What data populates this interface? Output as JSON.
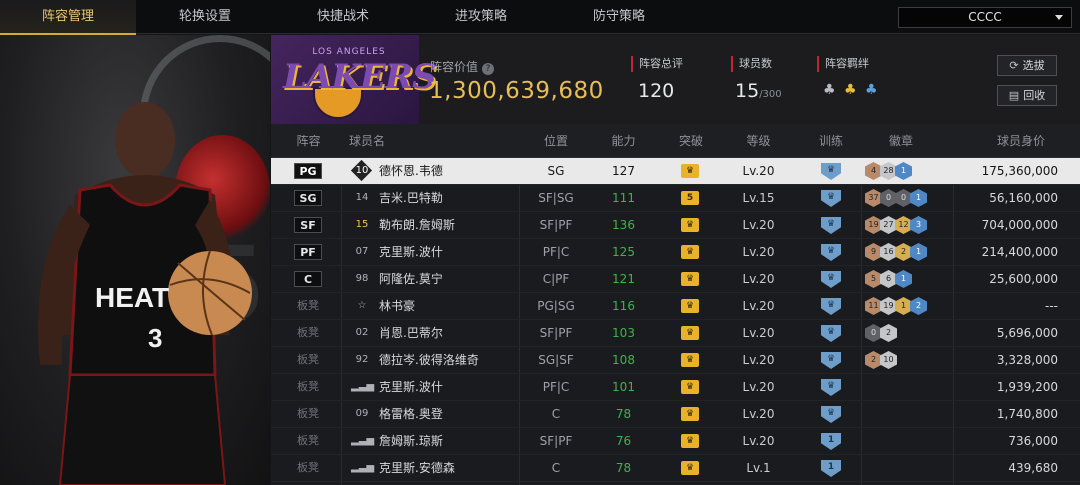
{
  "nav": {
    "tabs": [
      "阵容管理",
      "轮换设置",
      "快捷战术",
      "进攻策略",
      "防守策略"
    ],
    "active": 0,
    "team_select": "CCCC"
  },
  "team": {
    "logo_top": "LOS ANGELES",
    "logo_text": "LAKERS",
    "value_label": "阵容价值",
    "value": "1,300,639,680",
    "overall_label": "阵容总评",
    "overall": "120",
    "count_label": "球员数",
    "count": "15",
    "count_max": "/300",
    "bond_label": "阵容羁绊",
    "btn_select": "选拔",
    "btn_recycle": "回收"
  },
  "columns": [
    "阵容",
    "球员名",
    "位置",
    "能力",
    "突破",
    "等级",
    "训练",
    "徽章",
    "球员身价"
  ],
  "rows": [
    {
      "slot": "PG",
      "bench": false,
      "jersey": "10",
      "jstyle": "dia",
      "name": "德怀恩.韦德",
      "pos": "SG",
      "ability": "127",
      "break": "crown",
      "level": "Lv.20",
      "train": "crown",
      "badges": [
        [
          "4",
          "b-br"
        ],
        [
          "28",
          "b-si"
        ],
        [
          "1",
          "b-bl"
        ]
      ],
      "salary": "175,360,000"
    },
    {
      "slot": "SG",
      "bench": false,
      "jersey": "14",
      "jstyle": "",
      "name": "吉米.巴特勒",
      "pos": "SF|SG",
      "ability": "111",
      "break": "5",
      "level": "Lv.15",
      "train": "crown",
      "badges": [
        [
          "37",
          "b-br"
        ],
        [
          "0",
          "b-dk"
        ],
        [
          "0",
          "b-dk"
        ],
        [
          "1",
          "b-bl"
        ]
      ],
      "salary": "56,160,000"
    },
    {
      "slot": "SF",
      "bench": false,
      "jersey": "15",
      "jstyle": "gold",
      "name": "勒布朗.詹姆斯",
      "pos": "SF|PF",
      "ability": "136",
      "break": "crown",
      "level": "Lv.20",
      "train": "crown",
      "badges": [
        [
          "19",
          "b-br"
        ],
        [
          "27",
          "b-si"
        ],
        [
          "12",
          "b-go"
        ],
        [
          "3",
          "b-bl"
        ]
      ],
      "salary": "704,000,000"
    },
    {
      "slot": "PF",
      "bench": false,
      "jersey": "07",
      "jstyle": "",
      "name": "克里斯.波什",
      "pos": "PF|C",
      "ability": "125",
      "break": "crown",
      "level": "Lv.20",
      "train": "crown",
      "badges": [
        [
          "9",
          "b-br"
        ],
        [
          "16",
          "b-si"
        ],
        [
          "2",
          "b-go"
        ],
        [
          "1",
          "b-bl"
        ]
      ],
      "salary": "214,400,000"
    },
    {
      "slot": "C",
      "bench": false,
      "jersey": "98",
      "jstyle": "",
      "name": "阿隆佐.莫宁",
      "pos": "C|PF",
      "ability": "121",
      "break": "crown",
      "level": "Lv.20",
      "train": "crown",
      "badges": [
        [
          "5",
          "b-br"
        ],
        [
          "6",
          "b-si"
        ],
        [
          "1",
          "b-bl"
        ]
      ],
      "salary": "25,600,000"
    },
    {
      "slot": "",
      "bench": true,
      "bench_label": "板凳",
      "jersey": "☆",
      "jstyle": "",
      "name": "林书豪",
      "pos": "PG|SG",
      "ability": "116",
      "break": "crown",
      "level": "Lv.20",
      "train": "crown",
      "badges": [
        [
          "11",
          "b-br"
        ],
        [
          "19",
          "b-si"
        ],
        [
          "1",
          "b-go"
        ],
        [
          "2",
          "b-bl"
        ]
      ],
      "salary": "---"
    },
    {
      "slot": "",
      "bench": true,
      "bench_label": "板凳",
      "jersey": "02",
      "jstyle": "",
      "name": "肖恩.巴蒂尔",
      "pos": "SF|PF",
      "ability": "103",
      "break": "crown",
      "level": "Lv.20",
      "train": "crown",
      "badges": [
        [
          "0",
          "b-dk"
        ],
        [
          "2",
          "b-si"
        ]
      ],
      "salary": "5,696,000"
    },
    {
      "slot": "",
      "bench": true,
      "bench_label": "板凳",
      "jersey": "92",
      "jstyle": "",
      "name": "德拉岑.彼得洛维奇",
      "pos": "SG|SF",
      "ability": "108",
      "break": "crown",
      "level": "Lv.20",
      "train": "crown",
      "badges": [
        [
          "2",
          "b-br"
        ],
        [
          "10",
          "b-si"
        ]
      ],
      "salary": "3,328,000"
    },
    {
      "slot": "",
      "bench": true,
      "bench_label": "板凳",
      "jersey": "▂▃▅",
      "jstyle": "",
      "name": "克里斯.波什",
      "pos": "PF|C",
      "ability": "101",
      "break": "crown",
      "level": "Lv.20",
      "train": "crown",
      "badges": [],
      "salary": "1,939,200"
    },
    {
      "slot": "",
      "bench": true,
      "bench_label": "板凳",
      "jersey": "09",
      "jstyle": "",
      "name": "格雷格.奥登",
      "pos": "C",
      "ability": "78",
      "break": "crown",
      "level": "Lv.20",
      "train": "crown",
      "badges": [],
      "salary": "1,740,800"
    },
    {
      "slot": "",
      "bench": true,
      "bench_label": "板凳",
      "jersey": "▂▃▅",
      "jstyle": "",
      "name": "詹姆斯.琼斯",
      "pos": "SF|PF",
      "ability": "76",
      "break": "crown",
      "level": "Lv.20",
      "train": "1",
      "badges": [],
      "salary": "736,000"
    },
    {
      "slot": "",
      "bench": true,
      "bench_label": "板凳",
      "jersey": "▂▃▅",
      "jstyle": "",
      "name": "克里斯.安德森",
      "pos": "C",
      "ability": "78",
      "break": "crown",
      "level": "Lv.1",
      "train": "1",
      "badges": [],
      "salary": "439,680"
    }
  ],
  "hero": {
    "jersey_text": "HEAT",
    "jersey_number": "3",
    "bg_number": "5"
  }
}
